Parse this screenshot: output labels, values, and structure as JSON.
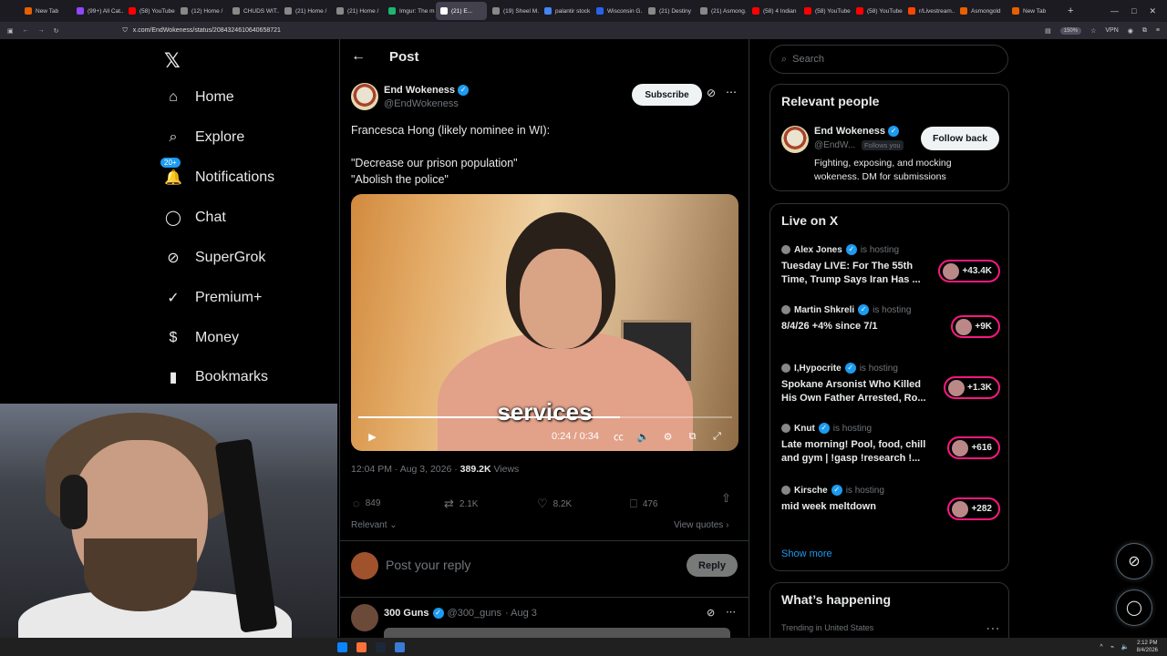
{
  "browser": {
    "tabs": [
      {
        "label": "New Tab",
        "color": "#e66000"
      },
      {
        "label": "(99+) All Cat...",
        "color": "#9146ff"
      },
      {
        "label": "(58) YouTube",
        "color": "#ff0000"
      },
      {
        "label": "(12) Home /",
        "color": "#888888"
      },
      {
        "label": "CHUDS WIT...",
        "color": "#888888"
      },
      {
        "label": "(21) Home /",
        "color": "#888888"
      },
      {
        "label": "(21) Home /",
        "color": "#888888"
      },
      {
        "label": "Imgur: The m",
        "color": "#1bb76e"
      },
      {
        "label": "(21) E...",
        "color": "#ffffff",
        "active": true
      },
      {
        "label": "(19) Sheel M...",
        "color": "#888888"
      },
      {
        "label": "palantir stock",
        "color": "#4285f4"
      },
      {
        "label": "Wisconsin G...",
        "color": "#2563eb"
      },
      {
        "label": "(21) Destiny",
        "color": "#888888"
      },
      {
        "label": "(21) Asmong...",
        "color": "#888888"
      },
      {
        "label": "(58) 4 Indian",
        "color": "#ff0000"
      },
      {
        "label": "(58) YouTube",
        "color": "#ff0000"
      },
      {
        "label": "(58) YouTube",
        "color": "#ff0000"
      },
      {
        "label": "r/Livestream...",
        "color": "#ff4500"
      },
      {
        "label": "Asmongold",
        "color": "#e66000"
      },
      {
        "label": "New Tab",
        "color": "#e66000"
      }
    ],
    "new_tab_icon": "+",
    "url": "x.com/EndWokeness/status/2084324610640658721",
    "zoom": "150%",
    "vpn_label": "VPN"
  },
  "nav": {
    "logo": "𝕏",
    "items": [
      {
        "label": "Home",
        "icon": "home-icon",
        "glyph": "⌂"
      },
      {
        "label": "Explore",
        "icon": "search-icon",
        "glyph": "⌕"
      },
      {
        "label": "Notifications",
        "icon": "bell-icon",
        "glyph": "🔔",
        "badge": "20+"
      },
      {
        "label": "Chat",
        "icon": "chat-bubble-icon",
        "glyph": "◯"
      },
      {
        "label": "SuperGrok",
        "icon": "grok-icon",
        "glyph": "⊘"
      },
      {
        "label": "Premium+",
        "icon": "verified-badge-icon",
        "glyph": "✓"
      },
      {
        "label": "Money",
        "icon": "dollar-icon",
        "glyph": "$"
      },
      {
        "label": "Bookmarks",
        "icon": "bookmark-icon",
        "glyph": "▮"
      }
    ]
  },
  "post": {
    "header_title": "Post",
    "back_glyph": "←",
    "author_name": "End Wokeness",
    "author_handle": "@EndWokeness",
    "subscribe_label": "Subscribe",
    "text_lines": [
      "Francesca Hong (likely nominee in WI):",
      "",
      "\"Decrease our prison population\"",
      "\"Abolish the police\""
    ],
    "video": {
      "subtitle": "services",
      "time": "0:24 / 0:34",
      "progress": 0.7
    },
    "timestamp": "12:04 PM · Aug 3, 2026 ·",
    "views_count": "389.2K",
    "views_label": "Views",
    "replies": "849",
    "reposts": "2.1K",
    "likes": "8.2K",
    "bookmarks": "476",
    "sort_label": "Relevant",
    "view_quotes_label": "View quotes",
    "reply_placeholder": "Post your reply",
    "reply_button": "Reply"
  },
  "next_tweet": {
    "name": "300 Guns",
    "handle": "@300_guns",
    "date": "· Aug 3"
  },
  "right": {
    "search_placeholder": "Search",
    "relevant_title": "Relevant people",
    "person": {
      "name": "End Wokeness",
      "handle": "@EndW...",
      "follows_you": "Follows you",
      "follow_button": "Follow back",
      "bio": "Fighting, exposing, and mocking wokeness. DM for submissions"
    },
    "live_title": "Live on X",
    "hosting_label": "is hosting",
    "live": [
      {
        "host": "Alex Jones",
        "title": "Tuesday LIVE: For The 55th Time, Trump Says Iran Has ...",
        "count": "+43.4K"
      },
      {
        "host": "Martin Shkreli",
        "title": "8/4/26 +4% since 7/1",
        "count": "+9K"
      },
      {
        "host": "I,Hypocrite",
        "title": "Spokane Arsonist Who Killed His Own Father Arrested, Ro...",
        "count": "+1.3K"
      },
      {
        "host": "Knut",
        "title": "Late morning! Pool, food, chill and gym | !gasp !research !...",
        "count": "+616"
      },
      {
        "host": "Kirsche",
        "title": "mid week meltdown",
        "count": "+282"
      }
    ],
    "show_more": "Show more",
    "whats_happening_title": "What’s happening",
    "trending_label": "Trending in United States"
  },
  "taskbar": {
    "time": "2:12 PM",
    "date": "8/4/2026"
  },
  "colors": {
    "accent": "#1d9bf0",
    "live": "#f91880",
    "border": "#2f3336",
    "muted": "#71767b"
  }
}
